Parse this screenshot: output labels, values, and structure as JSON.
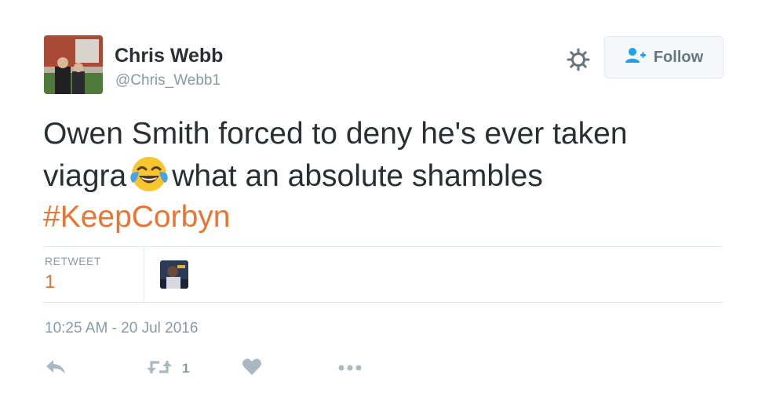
{
  "user": {
    "name": "Chris Webb",
    "handle": "@Chris_Webb1"
  },
  "follow_button": {
    "label": "Follow",
    "icon": "person-add-icon"
  },
  "settings_icon": "gear-icon",
  "tweet": {
    "text_line1": "Owen Smith forced to deny he's ever taken",
    "text_before_emoji": "viagra",
    "emoji": "face-with-tears-of-joy",
    "text_after_emoji": "what an absolute shambles",
    "hashtag": "#KeepCorbyn"
  },
  "stats": {
    "retweet_label": "RETWEET",
    "retweet_count": "1"
  },
  "timestamp": "10:25 AM - 20 Jul 2016",
  "actions": {
    "reply_icon": "reply-icon",
    "retweet_icon": "retweet-icon",
    "retweet_count": "1",
    "like_icon": "heart-icon",
    "more_icon": "more-dots-icon"
  },
  "colors": {
    "accent": "#e87531",
    "secondary_text": "#8899a6",
    "primary_text": "#292f33"
  }
}
